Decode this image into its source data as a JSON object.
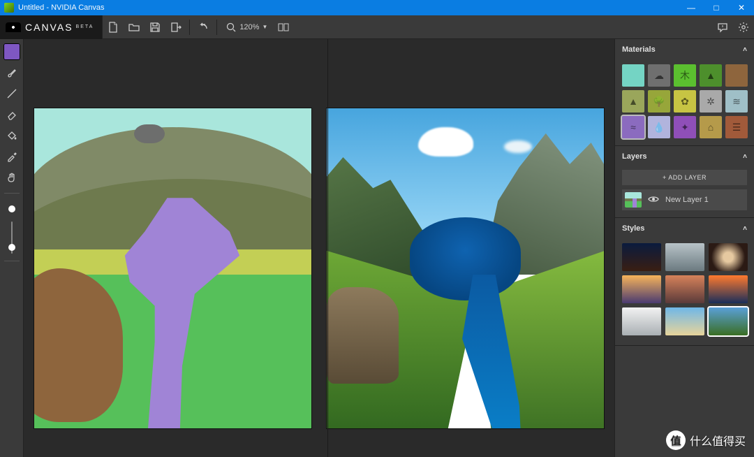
{
  "window": {
    "title": "Untitled - NVIDIA Canvas"
  },
  "brand": {
    "name": "CANVAS",
    "badge": "BETA"
  },
  "toolbar": {
    "new": "New",
    "open": "Open",
    "save": "Save",
    "export": "Export",
    "undo": "Undo",
    "zoom_label": "120%",
    "layout_toggle": "Layout"
  },
  "left_tools": {
    "items": [
      {
        "name": "material-blob",
        "active": true
      },
      {
        "name": "brush-tool"
      },
      {
        "name": "pencil-tool"
      },
      {
        "name": "eraser-tool"
      },
      {
        "name": "fill-tool"
      },
      {
        "name": "eyedropper-tool"
      },
      {
        "name": "pan-tool"
      }
    ]
  },
  "panels": {
    "materials": {
      "title": "Materials",
      "items": [
        {
          "name": "sky",
          "color": "#74d4c4",
          "glyph": "",
          "selected": false
        },
        {
          "name": "cloud",
          "color": "#6f6f6f",
          "glyph": "☁",
          "selected": false
        },
        {
          "name": "grass",
          "color": "#5bbf2f",
          "glyph": "⽊",
          "selected": false
        },
        {
          "name": "hill",
          "color": "#4d8f2c",
          "glyph": "▲",
          "selected": false
        },
        {
          "name": "dirt",
          "color": "#8e653d",
          "glyph": "",
          "selected": false
        },
        {
          "name": "mountain",
          "color": "#9aa65b",
          "glyph": "▲",
          "selected": false
        },
        {
          "name": "tree",
          "color": "#97a63a",
          "glyph": "🌳",
          "selected": false
        },
        {
          "name": "bush",
          "color": "#c7c443",
          "glyph": "✿",
          "selected": false
        },
        {
          "name": "snow",
          "color": "#a9a9a9",
          "glyph": "✲",
          "selected": false
        },
        {
          "name": "fog",
          "color": "#9fbfc7",
          "glyph": "≋",
          "selected": false
        },
        {
          "name": "water",
          "color": "#8b6bbf",
          "glyph": "≈",
          "selected": true
        },
        {
          "name": "rain",
          "color": "#b1b4dd",
          "glyph": "💧",
          "selected": false
        },
        {
          "name": "stars",
          "color": "#8f4fb8",
          "glyph": "✦",
          "selected": false
        },
        {
          "name": "sand",
          "color": "#b59a4a",
          "glyph": "⌂",
          "selected": false
        },
        {
          "name": "rock",
          "color": "#a15a3a",
          "glyph": "☰",
          "selected": false
        }
      ]
    },
    "layers": {
      "title": "Layers",
      "add_label": "+ ADD LAYER",
      "items": [
        {
          "name": "New Layer 1",
          "visible": true
        }
      ]
    },
    "styles": {
      "title": "Styles",
      "items": [
        {
          "name": "night-desert",
          "bg": "linear-gradient(#0a1b3e,#3a1e12)",
          "selected": false
        },
        {
          "name": "overcast-peak",
          "bg": "linear-gradient(#b8c3c8,#6b7a80)",
          "selected": false
        },
        {
          "name": "cave-glow",
          "bg": "radial-gradient(circle,#e6c9a0 20%,#2b1a14 70%)",
          "selected": false
        },
        {
          "name": "sunset-coast",
          "bg": "linear-gradient(#f7b45a,#4a3a70)",
          "selected": false
        },
        {
          "name": "red-mountain",
          "bg": "linear-gradient(#d7825a,#5a3a3a)",
          "selected": false
        },
        {
          "name": "ocean-sunset",
          "bg": "linear-gradient(#ff7a2e,#1a2e5a)",
          "selected": false
        },
        {
          "name": "snow-ridge",
          "bg": "linear-gradient(#f2f2f2,#aab0b4)",
          "selected": false
        },
        {
          "name": "beach-day",
          "bg": "linear-gradient(#6fb7e8,#e8d49a)",
          "selected": false
        },
        {
          "name": "alpine-lake",
          "bg": "linear-gradient(#5aa0d8,#3a6e23)",
          "selected": true
        }
      ]
    }
  },
  "watermark": {
    "badge": "值",
    "text": "什么值得买"
  }
}
